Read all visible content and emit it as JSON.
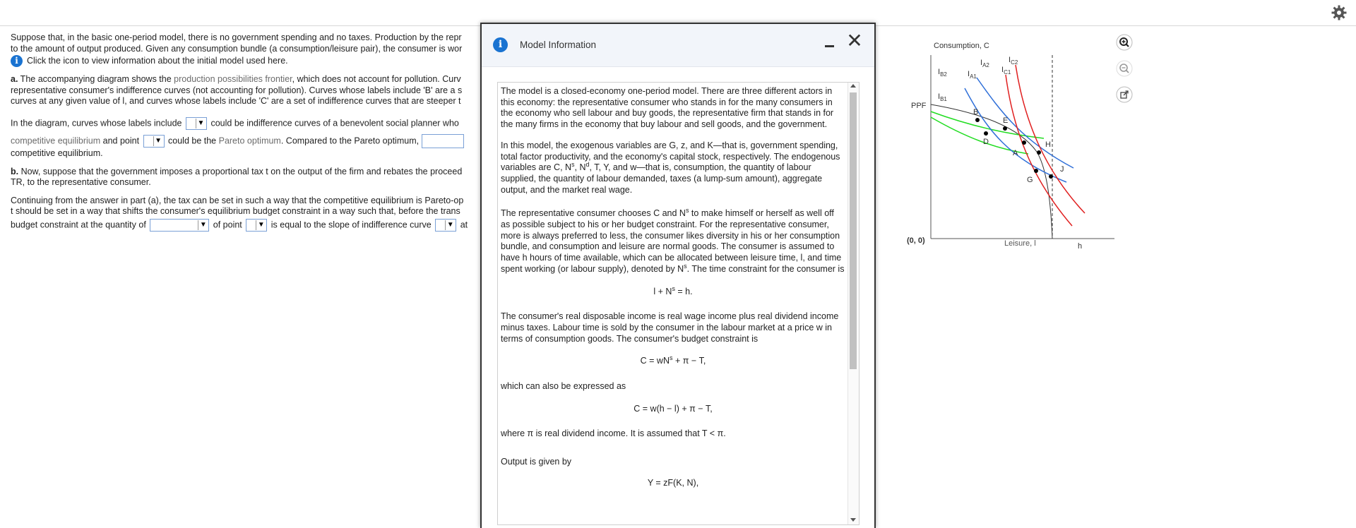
{
  "question": {
    "intro_line1": "Suppose that, in the basic one-period model, there is no government spending and no taxes. Production by the repr",
    "intro_line2": "to the amount of output produced. Given any consumption bundle (a consumption/leisure pair), the consumer is wor",
    "info_text": "Click the icon to view information about the initial model used here.",
    "part_a_label": "a.",
    "part_a_line1_pre": " The accompanying diagram shows the ",
    "part_a_term": "production possibilities frontier",
    "part_a_line1_post": ", which does not account for pollution. Curv",
    "part_a_line2": "representative consumer's indifference curves (not accounting for pollution). Curves whose labels include 'B' are a s",
    "part_a_line3": "curves at any given value of l, and curves whose labels include 'C' are a set of indifference curves that are steeper t",
    "diag_pre": "In the diagram, curves whose labels include",
    "diag_post": "could be indifference curves of a benevolent social planner who",
    "comp_eq": "competitive equilibrium",
    "and_point": " and point ",
    "could_be": "could be the ",
    "pareto": "Pareto optimum",
    "compared": ". Compared to the Pareto optimum,",
    "comp_eq2": "competitive equilibrium.",
    "part_b_label": "b.",
    "part_b_line1": " Now, suppose that the government imposes a proportional tax t on the output of the firm and rebates the proceed",
    "part_b_line2": "TR, to the representative consumer.",
    "cont_line1": "Continuing from the answer in part (a), the tax can be set in such a way that the competitive equilibrium is Pareto-op",
    "cont_line2": "t should be set in a way that shifts the consumer's equilibrium budget constraint in a way such that, before the trans",
    "cont_line3_pre": "budget constraint at the quantity of",
    "cont_line3_mid": "of point",
    "cont_line3_mid2": "is equal to the slope of indifference curve",
    "cont_line3_post": "at"
  },
  "modal": {
    "title": "Model Information",
    "p1": "The model is a closed-economy one-period model. There are three different actors in this economy: the representative consumer who stands in for the many consumers in the economy who sell labour and buy goods, the representative firm that stands in for the many firms in the economy that buy labour and sell goods, and the government.",
    "p2a": "In this model, the exogenous variables are G, z, and K—that is, government spending, total factor productivity, and the economy's capital stock, respectively. The endogenous variables are C, N",
    "p2b": ", N",
    "p2c": ", T, Y, and w—that is, consumption, the quantity of labour supplied, the quantity of labour demanded, taxes (a lump-sum amount), aggregate output, and the market real wage.",
    "sup_s": "s",
    "sup_d": "d",
    "p3a": "The representative consumer chooses C and N",
    "p3b": " to make himself or herself as well off as possible subject to his or her budget constraint. For the representative consumer, more is always preferred to less, the consumer likes diversity in his or her consumption bundle, and consumption and leisure are normal goods. The consumer is assumed to have h hours of time available, which can be allocated between leisure time, l, and time spent working (or labour supply), denoted by N",
    "p3c": ". The time constraint for the consumer is",
    "eq1a": "l + N",
    "eq1b": " = h.",
    "p4": "The consumer's real disposable income is real wage income plus real dividend income minus taxes. Labour time is sold by the consumer in the labour market at a price w in terms of consumption goods. The consumer's budget constraint is",
    "eq2a": "C = wN",
    "eq2b": " + π − T,",
    "p5": "which can also be expressed as",
    "eq3": "C = w(h − l) + π − T,",
    "p6": "where π is real dividend income. It is assumed that T < π.",
    "p7": "Output is given by",
    "eq4": "Y = zF(K, N),"
  },
  "graph": {
    "ylabel": "Consumption, C",
    "xlabel": "Leisure, l",
    "origin": "(0, 0)",
    "h_label": "h",
    "ppf_label": "PPF",
    "curves": {
      "IA2": "IA2",
      "IA1": "IA1",
      "IB2": "IB2",
      "IB1": "IB1",
      "IC2": "IC2",
      "IC1": "IC1"
    },
    "points": [
      "A",
      "B",
      "D",
      "E",
      "G",
      "H",
      "J"
    ],
    "colors": {
      "blue": "#2f6fd8",
      "green": "#22dd22",
      "red": "#e02020",
      "ppf": "#333333"
    }
  }
}
